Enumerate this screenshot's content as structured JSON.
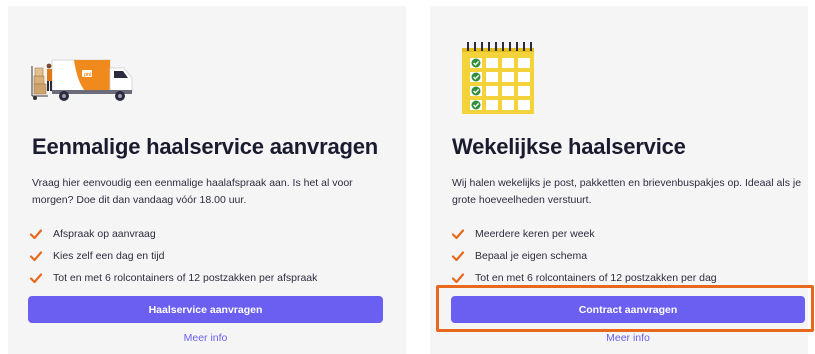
{
  "cards": [
    {
      "title": "Eenmalige haalservice aanvragen",
      "description": "Vraag hier eenvoudig een eenmalige haalafspraak aan. Is het al voor morgen? Doe dit dan vandaag vóór 18.00 uur.",
      "features": [
        "Afspraak op aanvraag",
        "Kies zelf een dag en tijd",
        "Tot en met 6 rolcontainers of 12 postzakken per afspraak"
      ],
      "button_label": "Haalservice aanvragen",
      "link_label": "Meer info",
      "illustration_icon": "delivery-truck-icon"
    },
    {
      "title": "Wekelijkse haalservice",
      "description": "Wij halen wekelijks je post, pakketten en brievenbuspakjes op. Ideaal als je grote hoeveelheden verstuurt.",
      "features": [
        "Meerdere keren per week",
        "Bepaal je eigen schema",
        "Tot en met 6 rolcontainers of 12 postzakken per dag"
      ],
      "button_label": "Contract aanvragen",
      "link_label": "Meer info",
      "illustration_icon": "calendar-icon"
    }
  ],
  "colors": {
    "accent": "#6a5ff0",
    "check": "#e8691e",
    "highlight": "#e8691e",
    "card_bg": "#f5f5f6",
    "calendar": "#f3d23a",
    "calendar_check": "#2f8f3a"
  }
}
